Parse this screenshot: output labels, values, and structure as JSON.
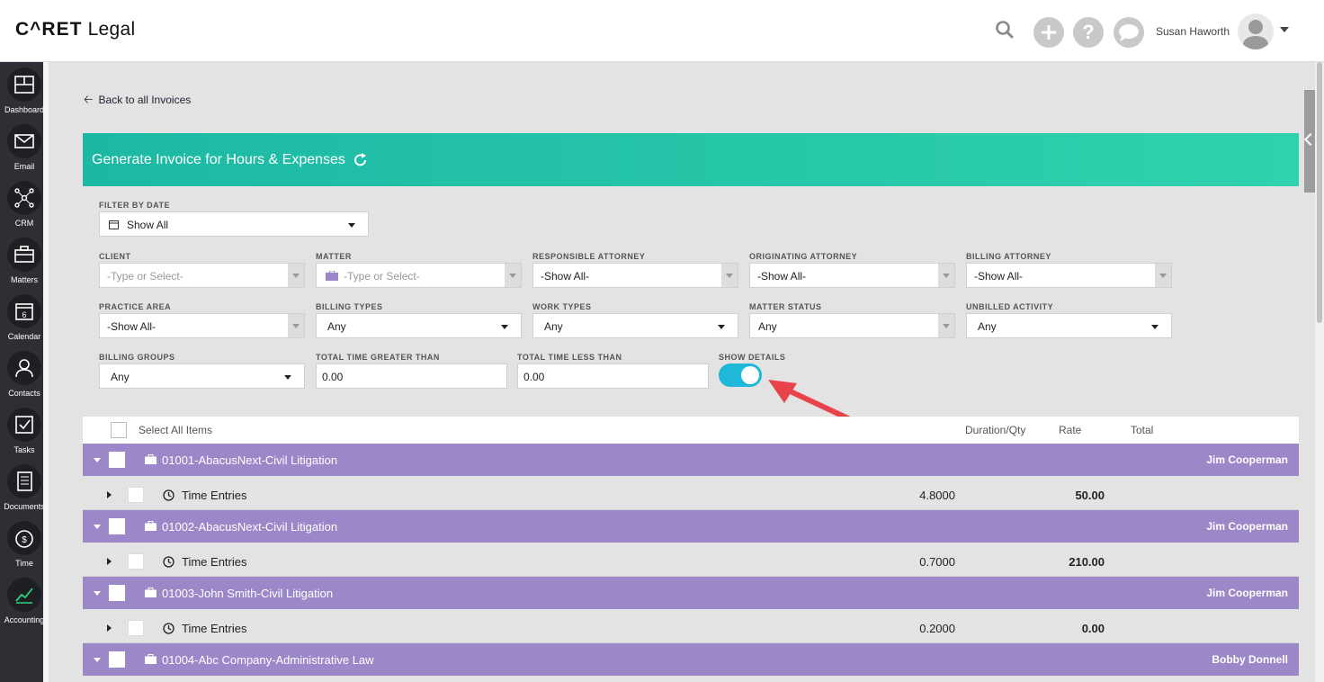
{
  "app": {
    "logo_main": "C^RET",
    "logo_sub": "Legal"
  },
  "header": {
    "user_name": "Susan Haworth",
    "add_icon": "plus-icon",
    "help_label": "?",
    "chat_icon": "chat-icon"
  },
  "sidebar": {
    "items": [
      {
        "label": "Dashboard",
        "icon": "dashboard-icon"
      },
      {
        "label": "Email",
        "icon": "email-icon"
      },
      {
        "label": "CRM",
        "icon": "crm-icon"
      },
      {
        "label": "Matters",
        "icon": "briefcase-icon"
      },
      {
        "label": "Calendar",
        "icon": "calendar-icon",
        "day": "6"
      },
      {
        "label": "Contacts",
        "icon": "contacts-icon"
      },
      {
        "label": "Tasks",
        "icon": "tasks-icon"
      },
      {
        "label": "Documents",
        "icon": "documents-icon"
      },
      {
        "label": "Time",
        "icon": "time-icon"
      },
      {
        "label": "Accounting",
        "icon": "accounting-icon"
      }
    ]
  },
  "nav": {
    "back_label": "Back to all Invoices"
  },
  "panel": {
    "title": "Generate Invoice for Hours & Expenses"
  },
  "filters": {
    "filter_by_date": {
      "label": "FILTER BY DATE",
      "value": "Show All"
    },
    "client": {
      "label": "CLIENT",
      "placeholder": "-Type or Select-"
    },
    "matter": {
      "label": "MATTER",
      "placeholder": "-Type or Select-"
    },
    "responsible_attorney": {
      "label": "RESPONSIBLE ATTORNEY",
      "value": "-Show All-"
    },
    "originating_attorney": {
      "label": "ORIGINATING ATTORNEY",
      "value": "-Show All-"
    },
    "billing_attorney": {
      "label": "BILLING ATTORNEY",
      "value": "-Show All-"
    },
    "practice_area": {
      "label": "PRACTICE AREA",
      "value": "-Show All-"
    },
    "billing_types": {
      "label": "BILLING TYPES",
      "value": "Any"
    },
    "work_types": {
      "label": "WORK TYPES",
      "value": "Any"
    },
    "matter_status": {
      "label": "MATTER STATUS",
      "value": "Any"
    },
    "unbilled_activity": {
      "label": "UNBILLED ACTIVITY",
      "value": "Any"
    },
    "billing_groups": {
      "label": "BILLING GROUPS",
      "value": "Any"
    },
    "total_time_greater": {
      "label": "TOTAL TIME GREATER THAN",
      "value": "0.00"
    },
    "total_time_less": {
      "label": "TOTAL TIME LESS THAN",
      "value": "0.00"
    },
    "show_details": {
      "label": "SHOW DETAILS",
      "on": true
    }
  },
  "list": {
    "select_all": "Select All Items",
    "columns": {
      "duration": "Duration/Qty",
      "rate": "Rate",
      "total": "Total"
    },
    "matters": [
      {
        "name": "01001-AbacusNext-Civil Litigation",
        "attorney": "Jim Cooperman",
        "entry": "Time Entries",
        "duration": "4.8000",
        "rate": "50.00"
      },
      {
        "name": "01002-AbacusNext-Civil Litigation",
        "attorney": "Jim Cooperman",
        "entry": "Time Entries",
        "duration": "0.7000",
        "rate": "210.00"
      },
      {
        "name": "01003-John Smith-Civil Litigation",
        "attorney": "Jim Cooperman",
        "entry": "Time Entries",
        "duration": "0.2000",
        "rate": "0.00"
      },
      {
        "name": "01004-Abc Company-Administrative Law",
        "attorney": "Bobby Donnell"
      }
    ]
  },
  "colors": {
    "header_gradient_start": "#1cb8a4",
    "header_gradient_end": "#2fd2ad",
    "matter_row": "#9c88c9",
    "toggle_on": "#1fb8d8",
    "sidebar": "#2d2f35",
    "annotation_arrow": "#e8424a"
  }
}
